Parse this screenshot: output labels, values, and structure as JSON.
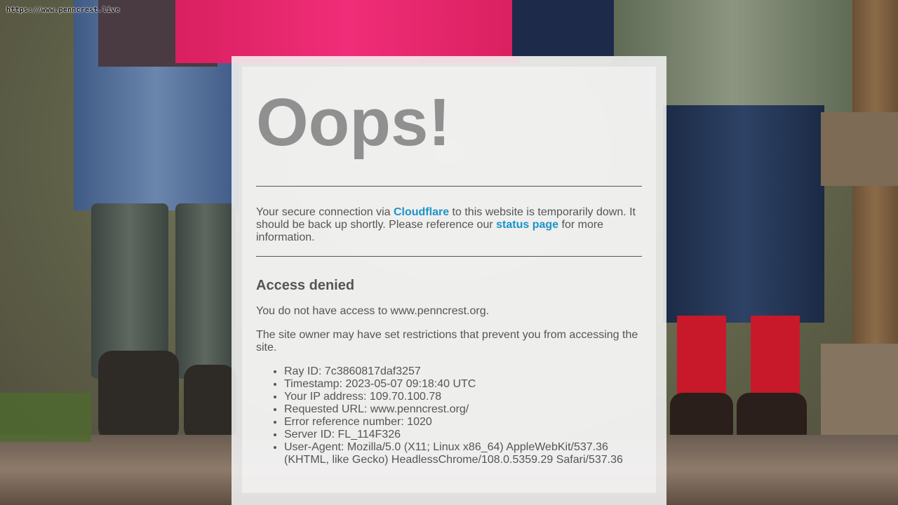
{
  "browser": {
    "url_text": "https://www.pennсrеst.live"
  },
  "colors": {
    "link": "#1d93c8",
    "heading_gray": "#909090",
    "text": "#555555"
  },
  "error_page": {
    "title": "Oops!",
    "intro": {
      "before_cloudflare": "Your secure connection via ",
      "cloudflare_link": "Cloudflare",
      "middle": " to this website is temporarily down. It should be back up shortly. Please reference our ",
      "status_link": "status page",
      "after": " for more information."
    },
    "section_heading": "Access denied",
    "no_access_text": "You do not have access to www.penncrest.org.",
    "restriction_text": "The site owner may have set restrictions that prevent you from accessing the site.",
    "details": [
      "Ray ID: 7c3860817daf3257",
      "Timestamp: 2023-05-07 09:18:40 UTC",
      "Your IP address: 109.70.100.78",
      "Requested URL: www.penncrest.org/",
      "Error reference number: 1020",
      "Server ID: FL_114F326",
      "User-Agent: Mozilla/5.0 (X11; Linux x86_64) AppleWebKit/537.36 (KHTML, like Gecko) HeadlessChrome/108.0.5359.29 Safari/537.36"
    ]
  }
}
